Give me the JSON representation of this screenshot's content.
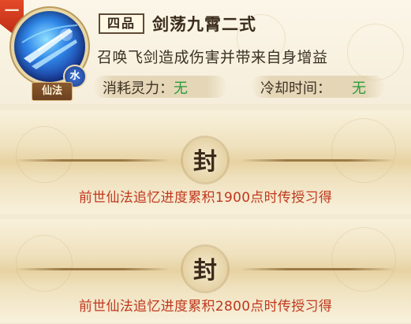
{
  "skill": {
    "rank_marker": "一",
    "grade": "四品",
    "name": "剑荡九霄二式",
    "description": "召唤飞剑造成伤害并带来自身增益",
    "element": "水",
    "type": "仙法",
    "icon": "flying-sword-icon",
    "cost_label": "消耗灵力：",
    "cost_value": "无",
    "cooldown_label": "冷却时间：",
    "cooldown_value": "无"
  },
  "locked_tiers": [
    {
      "seal": "封",
      "requirement": "前世仙法追忆进度累积1900点时传授习得"
    },
    {
      "seal": "封",
      "requirement": "前世仙法追忆进度累积2800点时传授习得"
    }
  ],
  "colors": {
    "accent_red": "#c0381e",
    "value_green": "#2c9a3a",
    "parchment": "#f3ead3"
  }
}
